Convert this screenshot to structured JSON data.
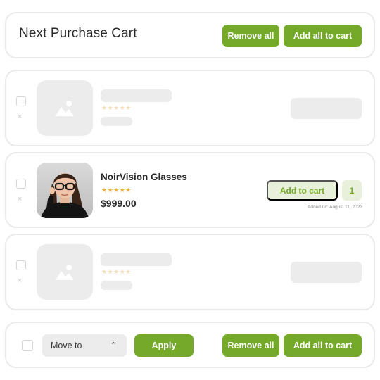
{
  "header": {
    "title": "Next Purchase Cart",
    "remove_all": "Remove all",
    "add_all": "Add all to cart"
  },
  "icons": {
    "remove": "close-icon",
    "placeholder": "image-placeholder-icon",
    "chevron": "chevron-up-icon",
    "star": "star-icon"
  },
  "items": [
    {
      "state": "loading"
    },
    {
      "state": "loaded",
      "name": "NoirVision Glasses",
      "rating_stars": "★★★★★",
      "price": "$999.00",
      "add_to_cart": "Add to cart",
      "quantity": "1",
      "added_on": "Added on: August 11, 2023"
    },
    {
      "state": "loading"
    }
  ],
  "skeleton_stars": "★★★★★",
  "remove_glyph": "×",
  "footer": {
    "move_to": "Move to",
    "chevron": "⌃",
    "apply": "Apply",
    "remove_all": "Remove all",
    "add_all": "Add all to cart"
  },
  "colors": {
    "accent": "#74a92a",
    "accent_light": "#e8f0dc",
    "skeleton": "#ececec",
    "star": "#f0a93a"
  }
}
